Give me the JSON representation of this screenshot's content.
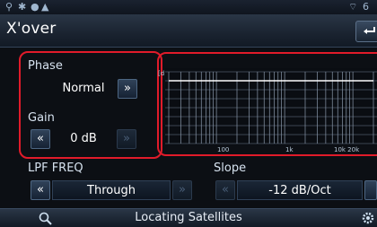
{
  "title": "X'over",
  "phase": {
    "label": "Phase",
    "value": "Normal",
    "next": "»"
  },
  "gain": {
    "label": "Gain",
    "prev": "«",
    "value": "0 dB",
    "next": "»"
  },
  "lpf": {
    "label": "LPF FREQ",
    "prev": "«",
    "value": "Through",
    "next": "»"
  },
  "slope": {
    "label": "Slope",
    "prev": "«",
    "value": "-12 dB/Oct"
  },
  "graph": {
    "db_tag": "[d",
    "ticks": [
      "100",
      "1k",
      "10k 20k"
    ]
  },
  "bottom": {
    "status": "Locating Satellites"
  },
  "colors": {
    "highlight": "#e11b2a",
    "accent": "#4d6682"
  }
}
